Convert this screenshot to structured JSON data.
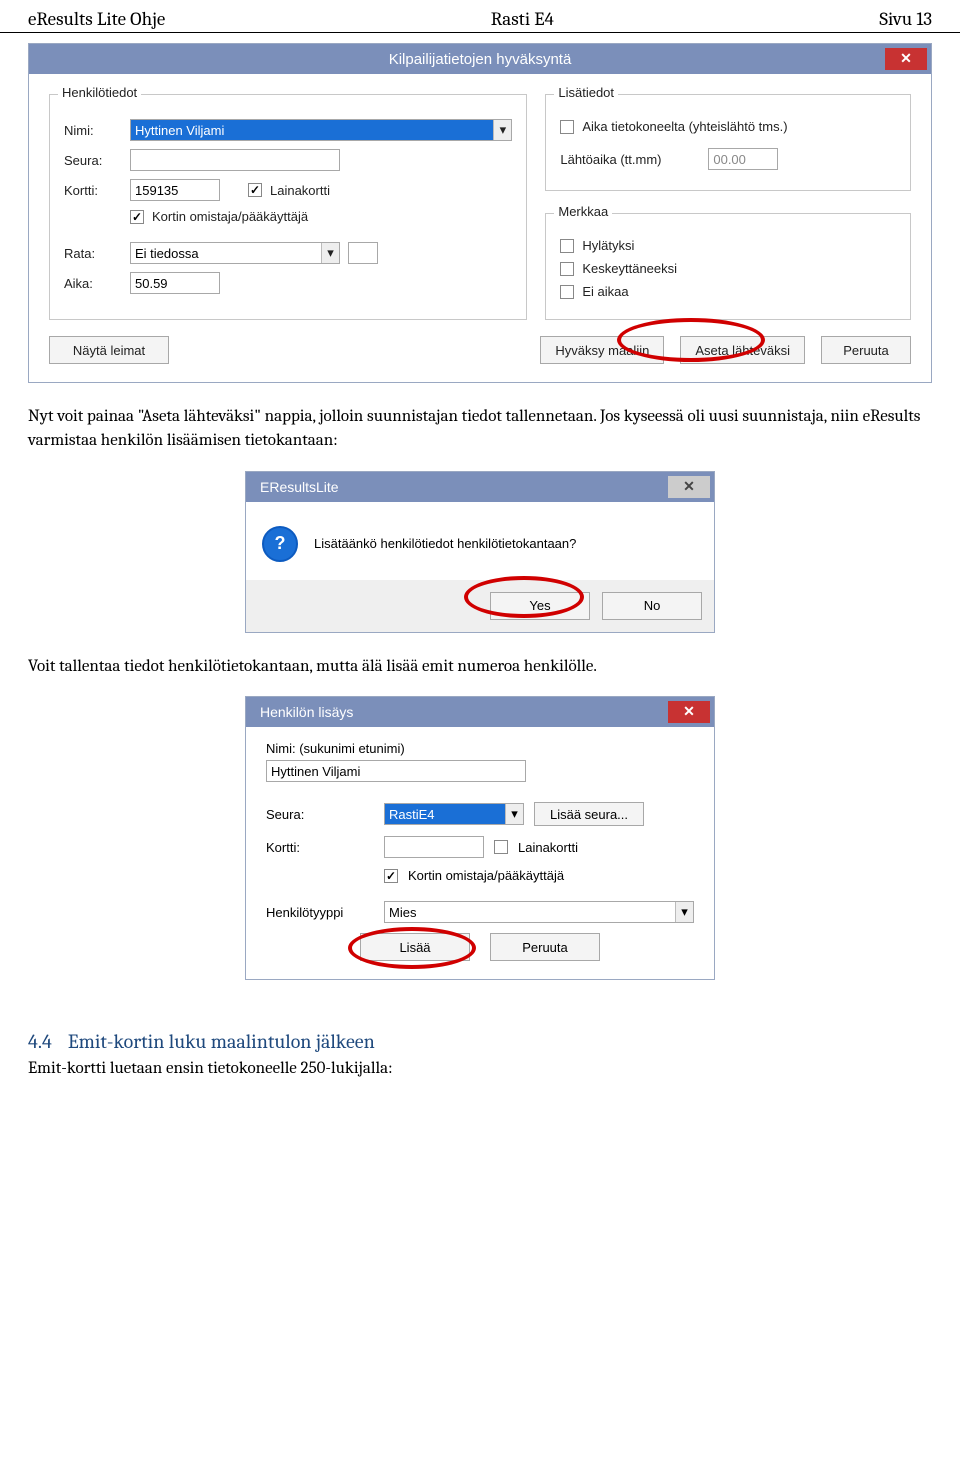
{
  "page": {
    "header_left": "eResults Lite Ohje",
    "header_center": "Rasti E4",
    "header_right": "Sivu 13"
  },
  "win1": {
    "title": "Kilpailijatietojen hyväksyntä",
    "group_personal": "Henkilötiedot",
    "group_extra": "Lisätiedot",
    "group_mark": "Merkkaa",
    "lbl_name": "Nimi:",
    "name_value": "Hyttinen Viljami",
    "lbl_club": "Seura:",
    "club_value": "",
    "lbl_card": "Kortti:",
    "card_value": "159135",
    "cb_loancard": "Lainakortti",
    "cb_owner": "Kortin omistaja/pääkäyttäjä",
    "lbl_course": "Rata:",
    "course_value": "Ei tiedossa",
    "lbl_time": "Aika:",
    "time_value": "50.59",
    "cb_computer_time": "Aika tietokoneelta (yhteislähtö tms.)",
    "lbl_starttime": "Lähtöaika (tt.mm)",
    "starttime_value": "00.00",
    "cb_disq": "Hylätyksi",
    "cb_dnf": "Keskeyttäneeksi",
    "cb_notime": "Ei aikaa",
    "btn_show": "Näytä leimat",
    "btn_accept": "Hyväksy maaliin",
    "btn_setstart": "Aseta lähteväksi",
    "btn_cancel": "Peruuta"
  },
  "para1": "Nyt voit painaa \"Aseta lähteväksi\" nappia, jolloin suunnistajan tiedot tallennetaan. Jos kyseessä oli uusi suunnistaja, niin eResults varmistaa henkilön lisäämisen tietokantaan:",
  "confirm": {
    "title": "EResultsLite",
    "question": "Lisätäänkö henkilötiedot henkilötietokantaan?",
    "yes": "Yes",
    "no": "No"
  },
  "para2": "Voit tallentaa tiedot henkilötietokantaan, mutta älä lisää emit numeroa henkilölle.",
  "person": {
    "title": "Henkilön lisäys",
    "lbl_name": "Nimi: (sukunimi etunimi)",
    "name_value": "Hyttinen Viljami",
    "lbl_club": "Seura:",
    "club_value": "RastiE4",
    "btn_addclub": "Lisää seura...",
    "lbl_card": "Kortti:",
    "card_value": "",
    "cb_loancard": "Lainakortti",
    "cb_owner": "Kortin omistaja/pääkäyttäjä",
    "lbl_type": "Henkilötyyppi",
    "type_value": "Mies",
    "btn_add": "Lisää",
    "btn_cancel": "Peruuta"
  },
  "section": {
    "num": "4.4",
    "title": "Emit-kortin luku maalintulon jälkeen",
    "body": "Emit-kortti luetaan ensin tietokoneelle 250-lukijalla:"
  }
}
